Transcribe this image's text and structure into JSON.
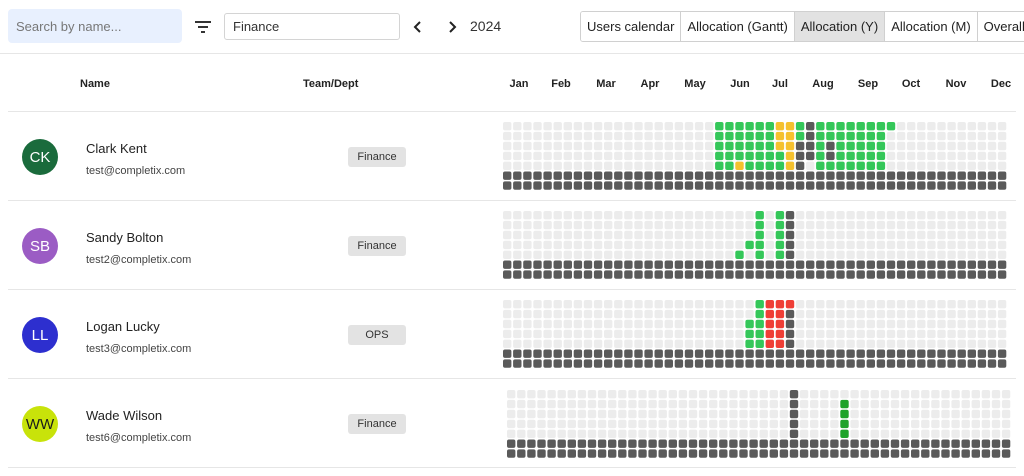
{
  "toolbar": {
    "search_placeholder": "Search by name...",
    "department_value": "Finance",
    "year": "2024",
    "view_tabs": [
      {
        "label": "Users calendar",
        "active": false
      },
      {
        "label": "Allocation (Gantt)",
        "active": false
      },
      {
        "label": "Allocation (Y)",
        "active": true
      },
      {
        "label": "Allocation (M)",
        "active": false
      },
      {
        "label": "Overall",
        "active": false
      }
    ]
  },
  "table": {
    "col_name": "Name",
    "col_team": "Team/Dept",
    "months": [
      "Jan",
      "Feb",
      "Mar",
      "Apr",
      "May",
      "Jun",
      "Jul",
      "Aug",
      "Sep",
      "Oct",
      "Nov",
      "Dec"
    ]
  },
  "colors": {
    "empty": "#ececec",
    "available": "#34c759",
    "partial": "#f5c12e",
    "overbooked": "#ef3e36",
    "holiday": "#5a5a5a"
  },
  "users": [
    {
      "initials": "CK",
      "name": "Clark Kent",
      "email": "test@completix.com",
      "team": "Finance",
      "avatar_color": "#1a6b3c",
      "avatar_text_color": "#ffffff",
      "cells": [
        {
          "col": 21,
          "rows": [
            0,
            1,
            2,
            3,
            4
          ],
          "c": "g"
        },
        {
          "col": 22,
          "rows": [
            0,
            1,
            2,
            3,
            4
          ],
          "c": "g"
        },
        {
          "col": 23,
          "rows": [
            0,
            1,
            2,
            3
          ],
          "c": "g"
        },
        {
          "col": 23,
          "rows": [
            4
          ],
          "c": "y"
        },
        {
          "col": 24,
          "rows": [
            0,
            1,
            2,
            3,
            4
          ],
          "c": "g"
        },
        {
          "col": 25,
          "rows": [
            0,
            1,
            2,
            3,
            4
          ],
          "c": "g"
        },
        {
          "col": 26,
          "rows": [
            0,
            1,
            2,
            3,
            4
          ],
          "c": "g"
        },
        {
          "col": 27,
          "rows": [
            0,
            1,
            2
          ],
          "c": "y"
        },
        {
          "col": 27,
          "rows": [
            3,
            4
          ],
          "c": "g"
        },
        {
          "col": 28,
          "rows": [
            0,
            1,
            2,
            3,
            4
          ],
          "c": "y"
        },
        {
          "col": 29,
          "rows": [
            0,
            1
          ],
          "c": "g"
        },
        {
          "col": 29,
          "rows": [
            2,
            3,
            4
          ],
          "c": "d"
        },
        {
          "col": 30,
          "rows": [
            0,
            1,
            2,
            3
          ],
          "c": "d"
        },
        {
          "col": 31,
          "rows": [
            0,
            1,
            2,
            3,
            4
          ],
          "c": "g"
        },
        {
          "col": 32,
          "rows": [
            0,
            1
          ],
          "c": "g"
        },
        {
          "col": 32,
          "rows": [
            2,
            3
          ],
          "c": "d"
        },
        {
          "col": 32,
          "rows": [
            4
          ],
          "c": "g"
        },
        {
          "col": 33,
          "rows": [
            0,
            1,
            2,
            3,
            4
          ],
          "c": "g"
        },
        {
          "col": 34,
          "rows": [
            0,
            1,
            2,
            3,
            4
          ],
          "c": "g"
        },
        {
          "col": 35,
          "rows": [
            0,
            1,
            2,
            3,
            4
          ],
          "c": "g"
        },
        {
          "col": 36,
          "rows": [
            0,
            1,
            2,
            3,
            4
          ],
          "c": "g"
        },
        {
          "col": 37,
          "rows": [
            0,
            1,
            2,
            3,
            4
          ],
          "c": "g"
        },
        {
          "col": 38,
          "rows": [
            0
          ],
          "c": "g"
        }
      ]
    },
    {
      "initials": "SB",
      "name": "Sandy Bolton",
      "email": "test2@completix.com",
      "team": "Finance",
      "avatar_color": "#9b5cc4",
      "avatar_text_color": "#ffffff",
      "cells": [
        {
          "col": 23,
          "rows": [
            4
          ],
          "c": "g"
        },
        {
          "col": 24,
          "rows": [
            3
          ],
          "c": "g"
        },
        {
          "col": 25,
          "rows": [
            0,
            1,
            2,
            3,
            4
          ],
          "c": "g"
        },
        {
          "col": 27,
          "rows": [
            0,
            1,
            2,
            3,
            4
          ],
          "c": "g"
        },
        {
          "col": 28,
          "rows": [
            0,
            1,
            2,
            3,
            4
          ],
          "c": "d"
        }
      ]
    },
    {
      "initials": "LL",
      "name": "Logan Lucky",
      "email": "test3@completix.com",
      "team": "OPS",
      "avatar_color": "#2d2fcf",
      "avatar_text_color": "#ffffff",
      "cells": [
        {
          "col": 24,
          "rows": [
            2,
            3,
            4
          ],
          "c": "g"
        },
        {
          "col": 25,
          "rows": [
            0,
            1,
            2,
            3,
            4
          ],
          "c": "g"
        },
        {
          "col": 26,
          "rows": [
            0,
            1,
            2,
            3,
            4
          ],
          "c": "r"
        },
        {
          "col": 27,
          "rows": [
            0,
            1,
            2,
            3,
            4
          ],
          "c": "r"
        },
        {
          "col": 28,
          "rows": [
            0
          ],
          "c": "r"
        },
        {
          "col": 28,
          "rows": [
            1,
            2,
            3,
            4
          ],
          "c": "d"
        }
      ]
    },
    {
      "initials": "WW",
      "name": "Wade Wilson",
      "email": "test6@completix.com",
      "team": "Finance",
      "avatar_color": "#c8e30a",
      "avatar_text_color": "#1a1a1a",
      "cells": [
        {
          "col": 28,
          "rows": [
            0,
            1,
            2,
            3,
            4
          ],
          "c": "d"
        },
        {
          "col": 33,
          "rows": [
            1
          ],
          "c": "dg"
        },
        {
          "col": 33,
          "rows": [
            2,
            3,
            4
          ],
          "c": "dg"
        }
      ]
    }
  ]
}
